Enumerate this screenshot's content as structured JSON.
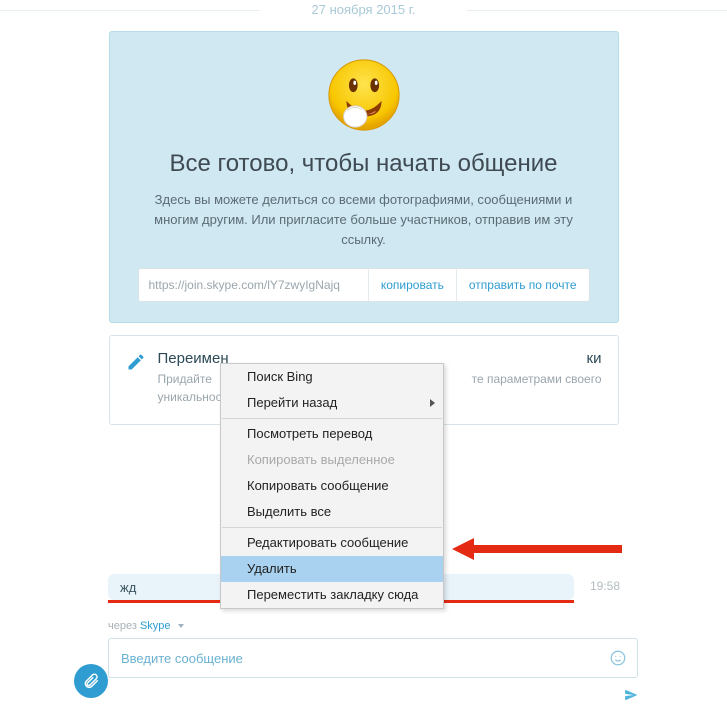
{
  "date_header": "27 ноября 2015 г.",
  "welcome": {
    "title": "Все готово, чтобы начать общение",
    "body": "Здесь вы можете делиться со всеми фотографиями, сообщениями и многим другим. Или пригласите больше участников, отправив им эту ссылку.",
    "link_value": "https://join.skype.com/lY7zwyIgNajq",
    "copy_label": "копировать",
    "mail_label": "отправить по почте"
  },
  "rename": {
    "title_visible": "Переимен",
    "title_right_visible": "ки",
    "body_visible_left": "Придайте",
    "body_visible_right": "те параметрами своего",
    "body_visible_bottom": "уникальнос"
  },
  "context_menu": {
    "items": [
      {
        "label": "Поиск Bing",
        "type": "item"
      },
      {
        "label": "Перейти назад",
        "type": "submenu"
      },
      {
        "type": "sep"
      },
      {
        "label": "Посмотреть перевод",
        "type": "item"
      },
      {
        "label": "Копировать выделенное",
        "type": "disabled"
      },
      {
        "label": "Копировать сообщение",
        "type": "item"
      },
      {
        "label": "Выделить все",
        "type": "item"
      },
      {
        "type": "sep"
      },
      {
        "label": "Редактировать сообщение",
        "type": "item"
      },
      {
        "label": "Удалить",
        "type": "highlight"
      },
      {
        "label": "Переместить закладку сюда",
        "type": "item"
      }
    ]
  },
  "message": {
    "text": "жд",
    "time": "19:58"
  },
  "via": {
    "prefix": "через ",
    "brand": "Skype"
  },
  "composer": {
    "placeholder": "Введите сообщение"
  }
}
